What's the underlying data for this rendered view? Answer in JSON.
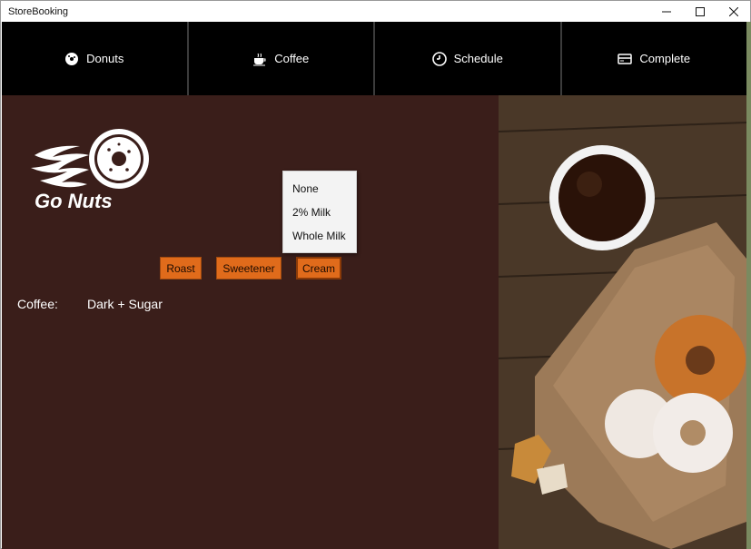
{
  "window": {
    "title": "StoreBooking"
  },
  "nav": {
    "items": [
      {
        "label": "Donuts"
      },
      {
        "label": "Coffee"
      },
      {
        "label": "Schedule"
      },
      {
        "label": "Complete"
      }
    ]
  },
  "logo": {
    "text": "Go Nuts"
  },
  "options": {
    "roast": "Roast",
    "sweetener": "Sweetener",
    "cream": "Cream"
  },
  "cream_menu": {
    "items": [
      "None",
      "2% Milk",
      "Whole Milk"
    ]
  },
  "summary": {
    "label": "Coffee:",
    "value": "Dark + Sugar"
  },
  "colors": {
    "accent": "#e06b1b",
    "panel": "#3a1e1a",
    "nav": "#000000"
  }
}
